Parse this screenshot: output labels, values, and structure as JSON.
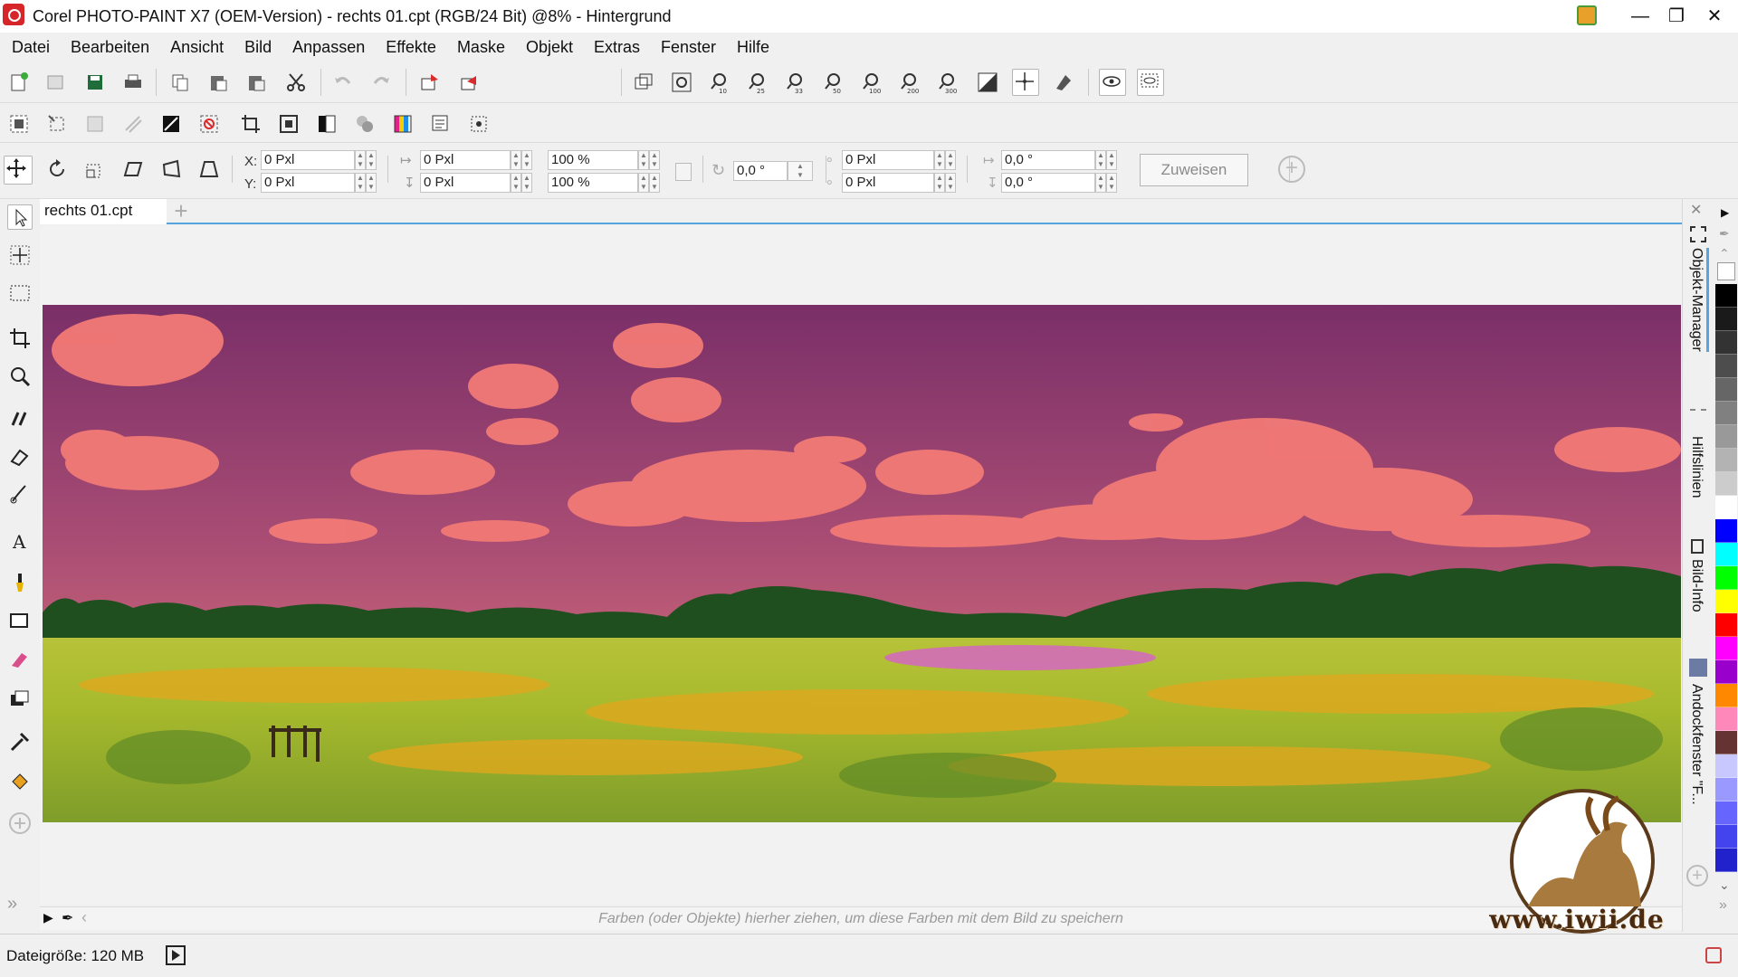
{
  "window": {
    "title": "Corel PHOTO-PAINT X7 (OEM-Version) - rechts 01.cpt (RGB/24 Bit) @8% - Hintergrund",
    "controls": [
      "minimize-icon",
      "maximize-icon",
      "close-icon"
    ]
  },
  "menu": {
    "items": [
      "Datei",
      "Bearbeiten",
      "Ansicht",
      "Bild",
      "Anpassen",
      "Effekte",
      "Maske",
      "Objekt",
      "Extras",
      "Fenster",
      "Hilfe"
    ]
  },
  "standard_toolbar": {
    "zoom_value": "8%",
    "zoom_presets": [
      "10",
      "25",
      "33",
      "50",
      "100",
      "200",
      "300"
    ]
  },
  "property_bar": {
    "x_label": "X:",
    "x_value": "0 Pxl",
    "y_label": "Y:",
    "y_value": "0 Pxl",
    "width_value": "0 Pxl",
    "height_value": "0 Pxl",
    "scale_w": "100 %",
    "scale_h": "100 %",
    "rotation": "0,0 °",
    "center_x": "0 Pxl",
    "center_y": "0 Pxl",
    "skew_h": "0,0 °",
    "skew_v": "0,0 °",
    "apply_button": "Zuweisen"
  },
  "document": {
    "tab_label": "rechts 01.cpt",
    "palette_hint": "Farben (oder Objekte) hierher ziehen, um diese Farben mit dem Bild zu speichern"
  },
  "dockers": {
    "tabs": [
      "Objekt-Manager",
      "Hilfslinien",
      "Bild-Info",
      "Andockfenster \"F..."
    ]
  },
  "palette": {
    "colors": [
      "#000000",
      "#1a1a1a",
      "#333333",
      "#4d4d4d",
      "#666666",
      "#808080",
      "#999999",
      "#b3b3b3",
      "#cccccc",
      "#ffffff",
      "#0000ff",
      "#00ffff",
      "#00ff00",
      "#ffff00",
      "#ff0000",
      "#ff00ff",
      "#9900cc",
      "#ff8800",
      "#ff88bb",
      "#663333",
      "#c8c8ff",
      "#9999ff",
      "#6666ff",
      "#4444ee",
      "#2222cc"
    ]
  },
  "status": {
    "text": "Dateigröße: 120 MB"
  },
  "watermark": {
    "text": "www.iwii.de"
  }
}
